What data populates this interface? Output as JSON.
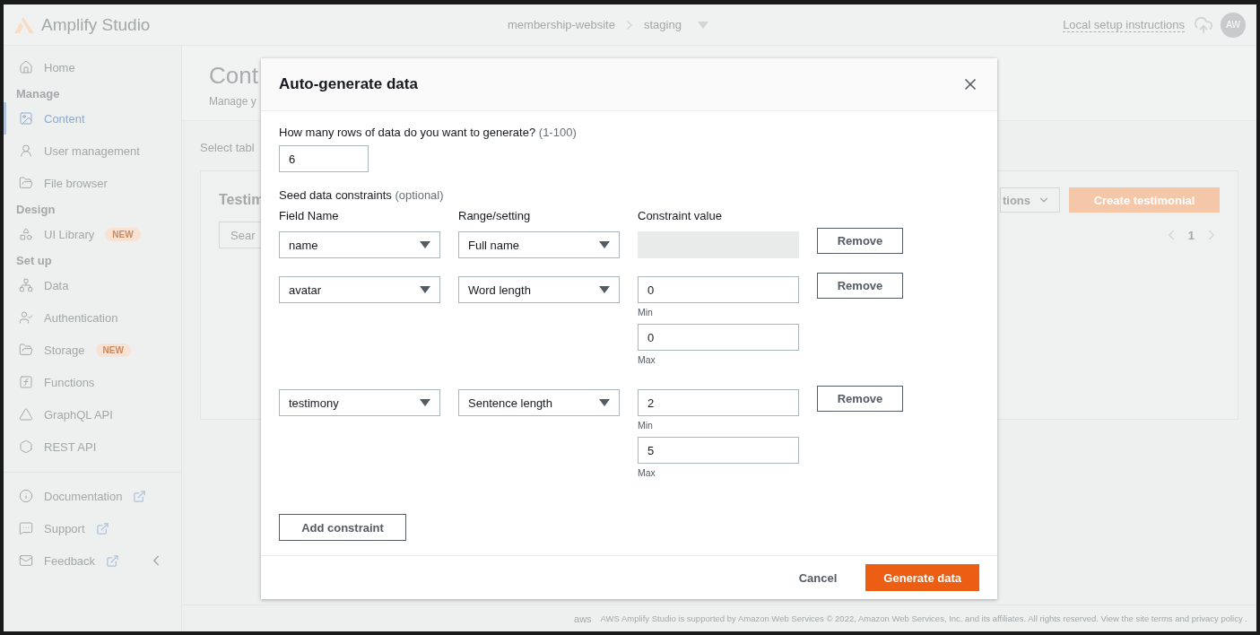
{
  "header": {
    "logo_text": "Amplify Studio",
    "breadcrumb": [
      "membership-website",
      "staging"
    ],
    "setup_link": "Local setup instructions",
    "avatar": "AW"
  },
  "sidebar": {
    "items": [
      {
        "kind": "item",
        "label": "Home",
        "selected": false
      },
      {
        "kind": "heading",
        "label": "Manage"
      },
      {
        "kind": "item",
        "label": "Content",
        "selected": true
      },
      {
        "kind": "item",
        "label": "User management",
        "selected": false
      },
      {
        "kind": "item",
        "label": "File browser",
        "selected": false
      },
      {
        "kind": "heading",
        "label": "Design"
      },
      {
        "kind": "item",
        "label": "UI Library",
        "badge": "NEW",
        "selected": false
      },
      {
        "kind": "heading",
        "label": "Set up"
      },
      {
        "kind": "item",
        "label": "Data",
        "selected": false
      },
      {
        "kind": "item",
        "label": "Authentication",
        "selected": false
      },
      {
        "kind": "item",
        "label": "Storage",
        "badge": "NEW",
        "selected": false
      },
      {
        "kind": "item",
        "label": "Functions",
        "selected": false
      },
      {
        "kind": "item",
        "label": "GraphQL API",
        "selected": false
      },
      {
        "kind": "item",
        "label": "REST API",
        "selected": false
      },
      {
        "kind": "divider"
      },
      {
        "kind": "link",
        "label": "Documentation"
      },
      {
        "kind": "link",
        "label": "Support"
      },
      {
        "kind": "link",
        "label": "Feedback"
      }
    ]
  },
  "page": {
    "title": "Cont",
    "subtitle": "Manage y",
    "select_label": "Select tabl",
    "card_title": "Testim",
    "search_placeholder": "Sear",
    "actions_button": "tions",
    "create_button": "Create testimonial",
    "page_number": "1"
  },
  "footer_logo": "aws",
  "footer": "AWS Amplify Studio is supported by Amazon Web Services © 2022, Amazon Web Services, Inc. and its affiliates. All rights reserved. View the site terms and privacy policy .",
  "dialog": {
    "title": "Auto-generate data",
    "rows_label": "How many rows of data do you want to generate?",
    "rows_hint": "(1-100)",
    "rows_value": "6",
    "constraints_label": "Seed data constraints",
    "constraints_hint": "(optional)",
    "columns": [
      "Field Name",
      "Range/setting",
      "Constraint value"
    ],
    "constraints": [
      {
        "kind": "none",
        "field": "name",
        "setting": "Full name",
        "remove": "Remove"
      },
      {
        "kind": "range",
        "field": "avatar",
        "setting": "Word length",
        "min": "0",
        "min_label": "Min",
        "max": "0",
        "max_label": "Max",
        "remove": "Remove"
      },
      {
        "kind": "range",
        "field": "testimony",
        "setting": "Sentence length",
        "min": "2",
        "min_label": "Min",
        "max": "5",
        "max_label": "Max",
        "remove": "Remove"
      }
    ],
    "add_button": "Add constraint",
    "cancel_button": "Cancel",
    "generate_button": "Generate data"
  }
}
